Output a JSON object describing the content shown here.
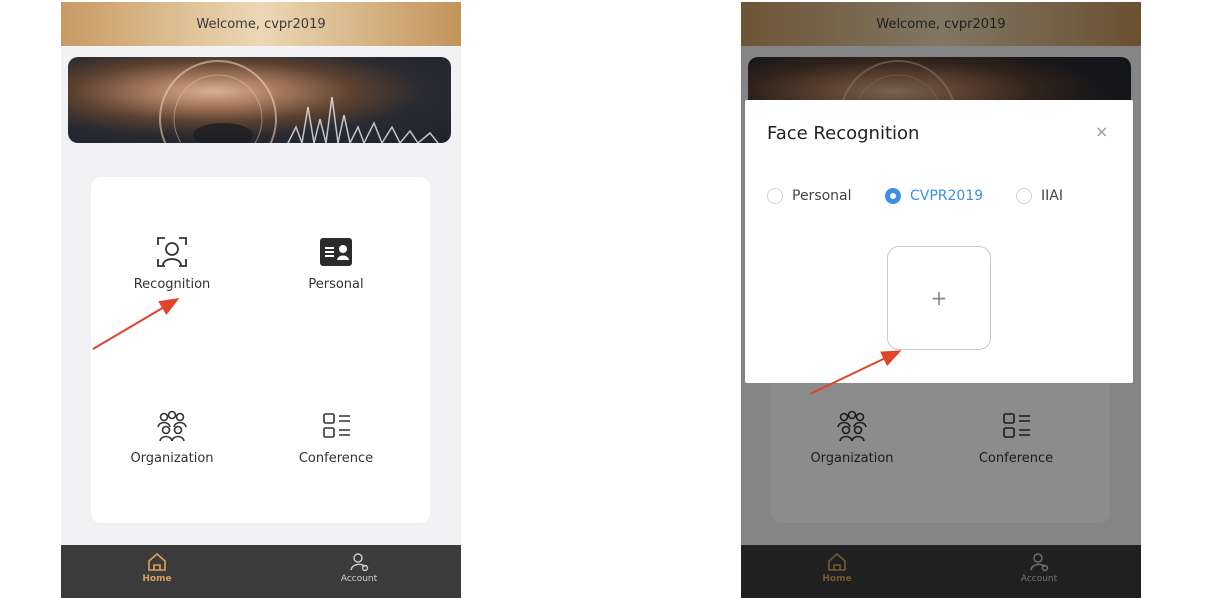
{
  "app": {
    "welcome": "Welcome, cvpr2019"
  },
  "menu": {
    "recognition": "Recognition",
    "personal": "Personal",
    "organization": "Organization",
    "conference": "Conference"
  },
  "icons": {
    "recognition": "face-scan-icon",
    "personal": "id-card-icon",
    "organization": "group-icon",
    "conference": "list-icon",
    "home": "home-icon",
    "account": "account-icon"
  },
  "tabbar": {
    "home": "Home",
    "account": "Account"
  },
  "modal": {
    "title": "Face Recognition",
    "close": "×",
    "options": [
      "Personal",
      "CVPR2019",
      "IIAI"
    ],
    "selected": "CVPR2019",
    "upload": "+"
  },
  "colors": {
    "accent": "#d9a25a",
    "radio_selected": "#3a8fe8",
    "annotation_arrow": "#e0452c",
    "tabbar": "#3b3b3b"
  }
}
